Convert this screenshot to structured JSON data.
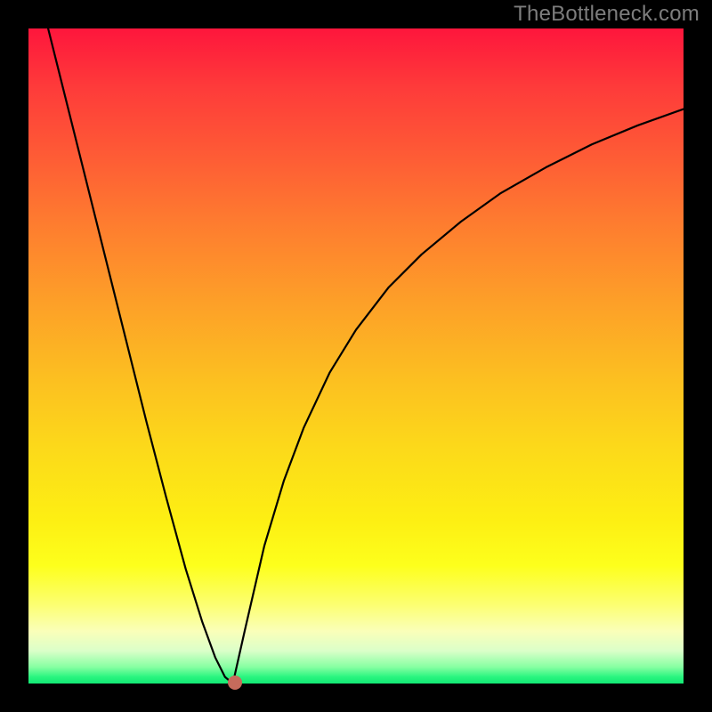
{
  "watermark": "TheBottleneck.com",
  "chart_data": {
    "type": "line",
    "title": "",
    "xlabel": "",
    "ylabel": "",
    "xlim": [
      0,
      1
    ],
    "ylim": [
      0,
      1
    ],
    "series": [
      {
        "name": "left-branch",
        "x": [
          0.03,
          0.06,
          0.09,
          0.12,
          0.15,
          0.18,
          0.21,
          0.24,
          0.265,
          0.285,
          0.3,
          0.312
        ],
        "values": [
          0.0,
          0.12,
          0.24,
          0.36,
          0.48,
          0.6,
          0.715,
          0.825,
          0.905,
          0.96,
          0.99,
          1.0
        ]
      },
      {
        "name": "right-branch",
        "x": [
          0.312,
          0.33,
          0.36,
          0.39,
          0.42,
          0.46,
          0.5,
          0.55,
          0.6,
          0.66,
          0.72,
          0.79,
          0.86,
          0.93,
          1.0
        ],
        "values": [
          1.0,
          0.92,
          0.79,
          0.69,
          0.61,
          0.525,
          0.46,
          0.395,
          0.345,
          0.295,
          0.252,
          0.212,
          0.177,
          0.148,
          0.123
        ]
      }
    ],
    "marker": {
      "x": 0.315,
      "y": 0.998
    },
    "background_gradient": {
      "top": "#fe163c",
      "mid": "#fcd91a",
      "bottom": "#12e874"
    }
  }
}
